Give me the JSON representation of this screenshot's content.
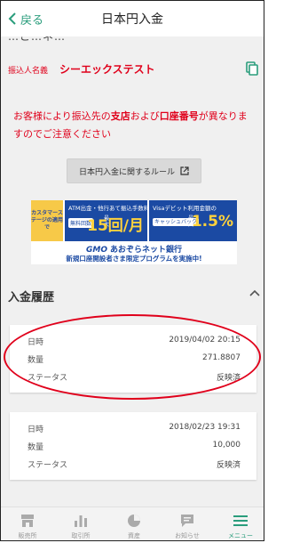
{
  "header": {
    "back_label": "戻る",
    "title": "日本円入金"
  },
  "top_partial_text": "…こ…ネ…",
  "payee": {
    "label": "振込人名義",
    "value": "シーエックステスト"
  },
  "notice": {
    "part1": "お客様により振込先の",
    "bold1": "支店",
    "part2": "および",
    "bold2": "口座番号",
    "part3": "が異なりますのでご注意ください"
  },
  "rule_button_label": "日本円入金に関するルール",
  "banner": {
    "left_text": "カスタマーステージの適用で",
    "mid_small": "ATM出金・他行あて振込手数料",
    "mid_tag": "無料回数",
    "mid_max": "最大",
    "mid_big": "15回/月",
    "right_small": "Visaデビット利用金額の",
    "right_tag": "キャッシュバック",
    "right_max": "最大",
    "right_big": "1.5%",
    "logo_gmo": "GMO",
    "logo_text": "あおぞらネット銀行",
    "promo": "新規口座開設者さま限定プログラムを実施中!"
  },
  "history": {
    "title": "入金履歴",
    "entries": [
      {
        "date_label": "日時",
        "date_value": "2019/04/02 20:15",
        "qty_label": "数量",
        "qty_value": "271.8807",
        "status_label": "ステータス",
        "status_value": "反映済"
      },
      {
        "date_label": "日時",
        "date_value": "2018/02/23 19:31",
        "qty_label": "数量",
        "qty_value": "10,000",
        "status_label": "ステータス",
        "status_value": "反映済"
      }
    ]
  },
  "bottom_nav": [
    {
      "label": "販売所",
      "icon": "shop-icon"
    },
    {
      "label": "取引所",
      "icon": "chart-bar-icon"
    },
    {
      "label": "資産",
      "icon": "pie-chart-icon"
    },
    {
      "label": "お知らせ",
      "icon": "message-icon"
    },
    {
      "label": "メニュー",
      "icon": "menu-icon",
      "active": true
    }
  ],
  "colors": {
    "accent": "#2a9d7c",
    "warning_red": "#e0001b",
    "banner_blue": "#1b4aa3",
    "banner_yellow": "#f7c948"
  }
}
